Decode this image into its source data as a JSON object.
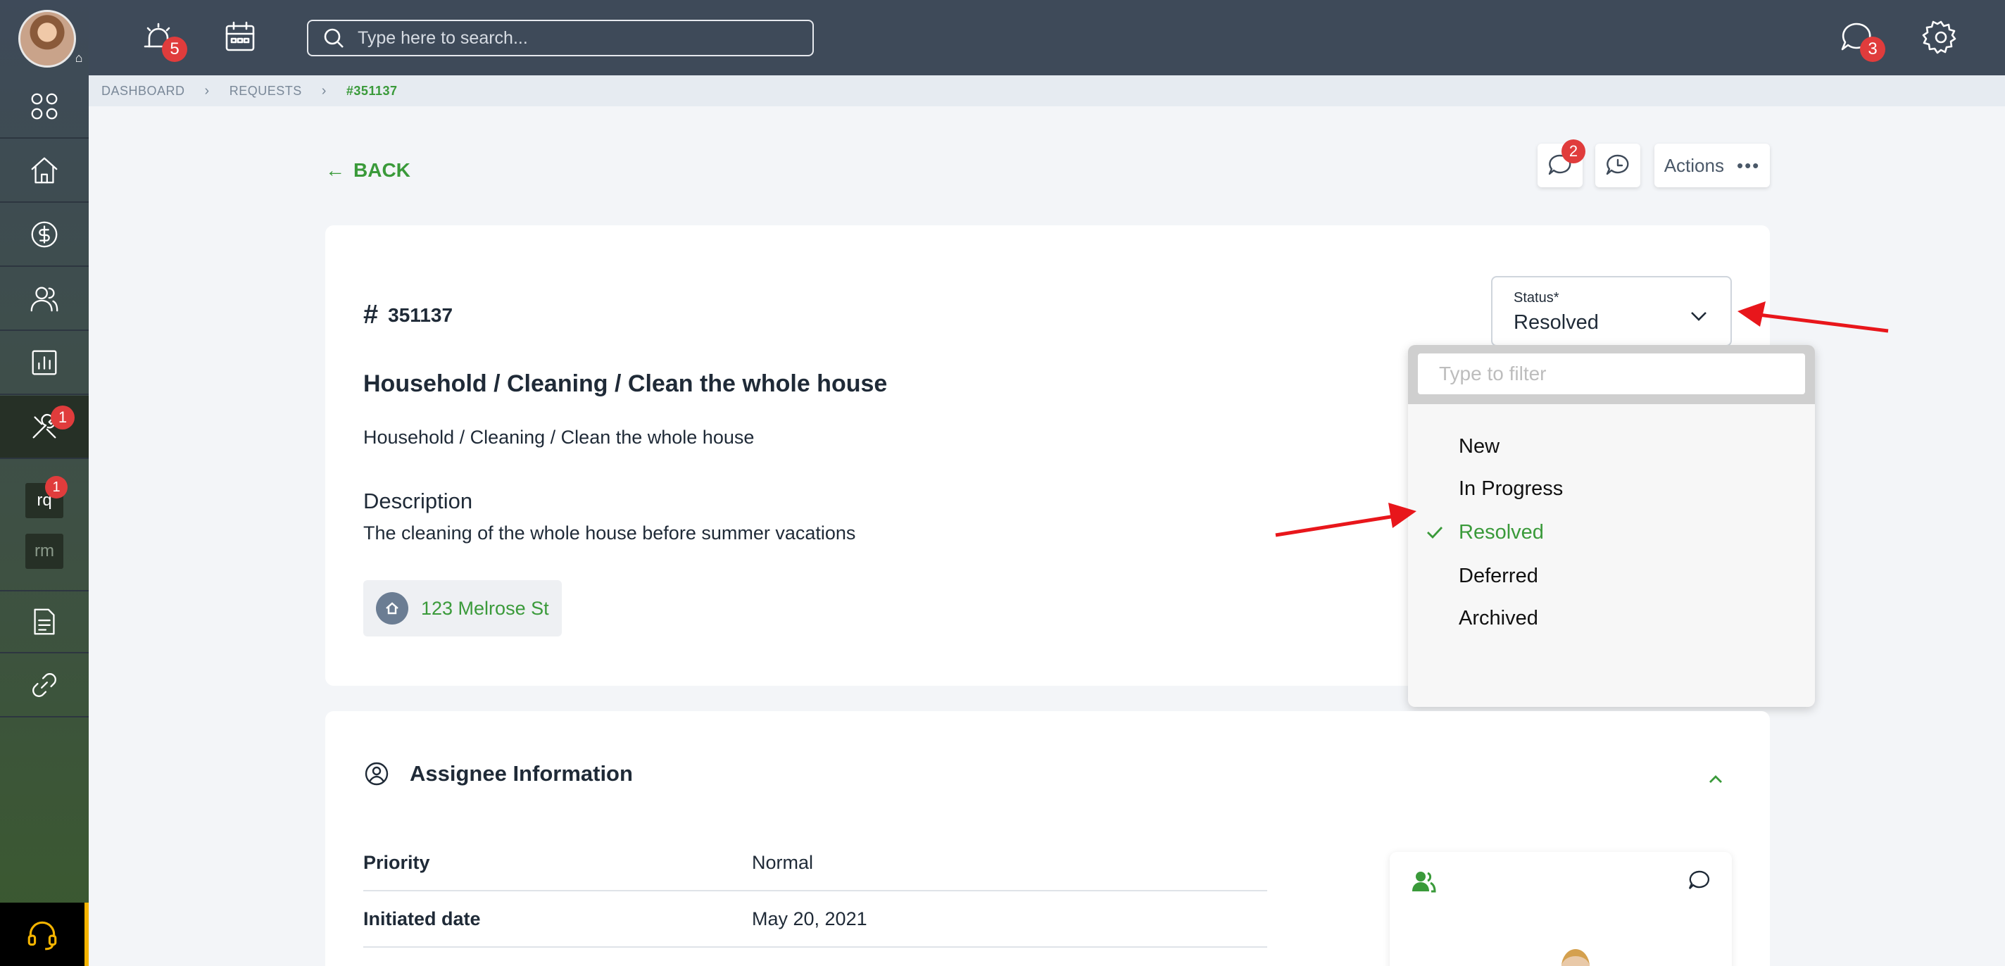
{
  "topbar": {
    "alarm_badge": "5",
    "chat_badge": "3",
    "search_placeholder": "Type here to search..."
  },
  "sidebar": {
    "tools_badge": "1",
    "rq_label": "rq",
    "rq_badge": "1",
    "rm_label": "rm"
  },
  "breadcrumb": {
    "items": [
      "DASHBOARD",
      "REQUESTS"
    ],
    "current": "#351137"
  },
  "toolbar": {
    "back_label": "BACK",
    "comments_badge": "2",
    "actions_label": "Actions"
  },
  "request": {
    "id": "351137",
    "title": "Household / Cleaning / Clean the whole house",
    "category": "Household / Cleaning / Clean the whole house",
    "description_heading": "Description",
    "description": "The cleaning of the whole house before summer vacations",
    "address": "123 Melrose St"
  },
  "status": {
    "label": "Status*",
    "value": "Resolved",
    "filter_placeholder": "Type to filter",
    "options": [
      "New",
      "In Progress",
      "Resolved",
      "Deferred",
      "Archived"
    ],
    "selected_index": 2
  },
  "assignee": {
    "heading": "Assignee Information",
    "rows": [
      {
        "key": "Priority",
        "value": "Normal"
      },
      {
        "key": "Initiated date",
        "value": "May 20, 2021"
      }
    ]
  },
  "colors": {
    "accent_green": "#3a9a3a",
    "badge_red": "#e03c3c",
    "topbar": "#3e4a59"
  }
}
